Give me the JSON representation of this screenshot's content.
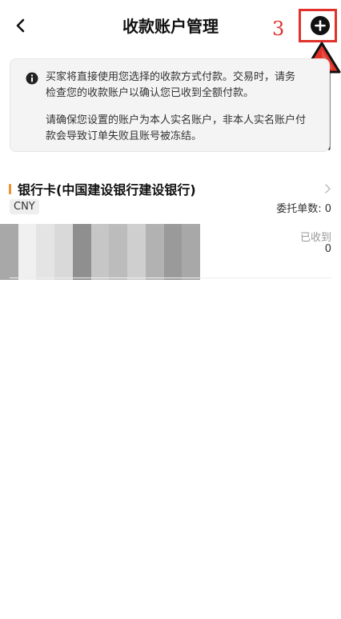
{
  "header": {
    "title": "收款账户管理",
    "back_icon": "chevron-left-icon",
    "add_icon": "plus-circle-icon",
    "annotation_number": "3",
    "annotation_color": "#e0322b"
  },
  "notice": {
    "icon": "info-icon",
    "line1": "买家将直接使用您选择的收款方式付款。交易时，请务",
    "line2": "检查您的收款账户以确认您已收到全额付款。",
    "line3": "请确保您设置的账户为本人实名账户，非本人实名账户付",
    "line4": "款会导致订单失败且账号被冻结。"
  },
  "account": {
    "name": "银行卡(中国建设银行建设银行)",
    "accent_color": "#f0902a",
    "currency": "CNY",
    "orders_label": "委托单数:",
    "orders_value": "0",
    "received_label": "已收到",
    "received_value": "0",
    "details_redacted": true
  }
}
